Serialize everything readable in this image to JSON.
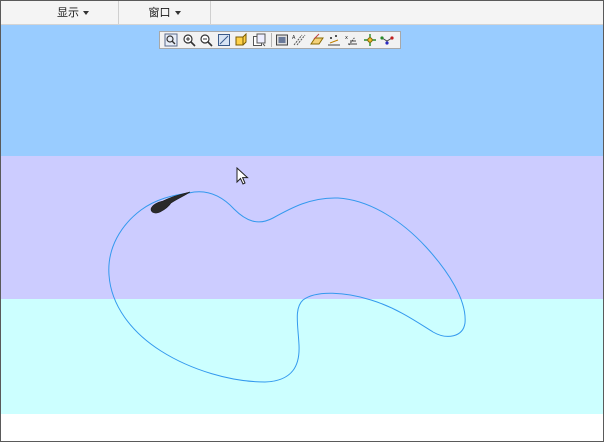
{
  "menubar": {
    "items": [
      {
        "label": "显示"
      },
      {
        "label": "窗口"
      }
    ]
  },
  "toolbar": {
    "tools": [
      {
        "icon": "zoom-window-icon"
      },
      {
        "icon": "zoom-in-icon"
      },
      {
        "icon": "zoom-out-icon"
      },
      {
        "icon": "refit-icon"
      },
      {
        "icon": "shaded-view-icon"
      },
      {
        "icon": "saved-views-icon"
      },
      {
        "icon": "display-settings-icon"
      },
      {
        "icon": "axis-display-icon"
      },
      {
        "icon": "plane-display-icon"
      },
      {
        "icon": "point-display-icon"
      },
      {
        "icon": "csys-display-icon"
      },
      {
        "icon": "spin-center-icon"
      },
      {
        "icon": "annotation-display-icon"
      }
    ]
  },
  "colors": {
    "band_top": "#99ccff",
    "band_middle": "#ccccff",
    "band_bottom": "#ccffff",
    "curve": "#3399ee",
    "worm": "#2a2a2a"
  }
}
